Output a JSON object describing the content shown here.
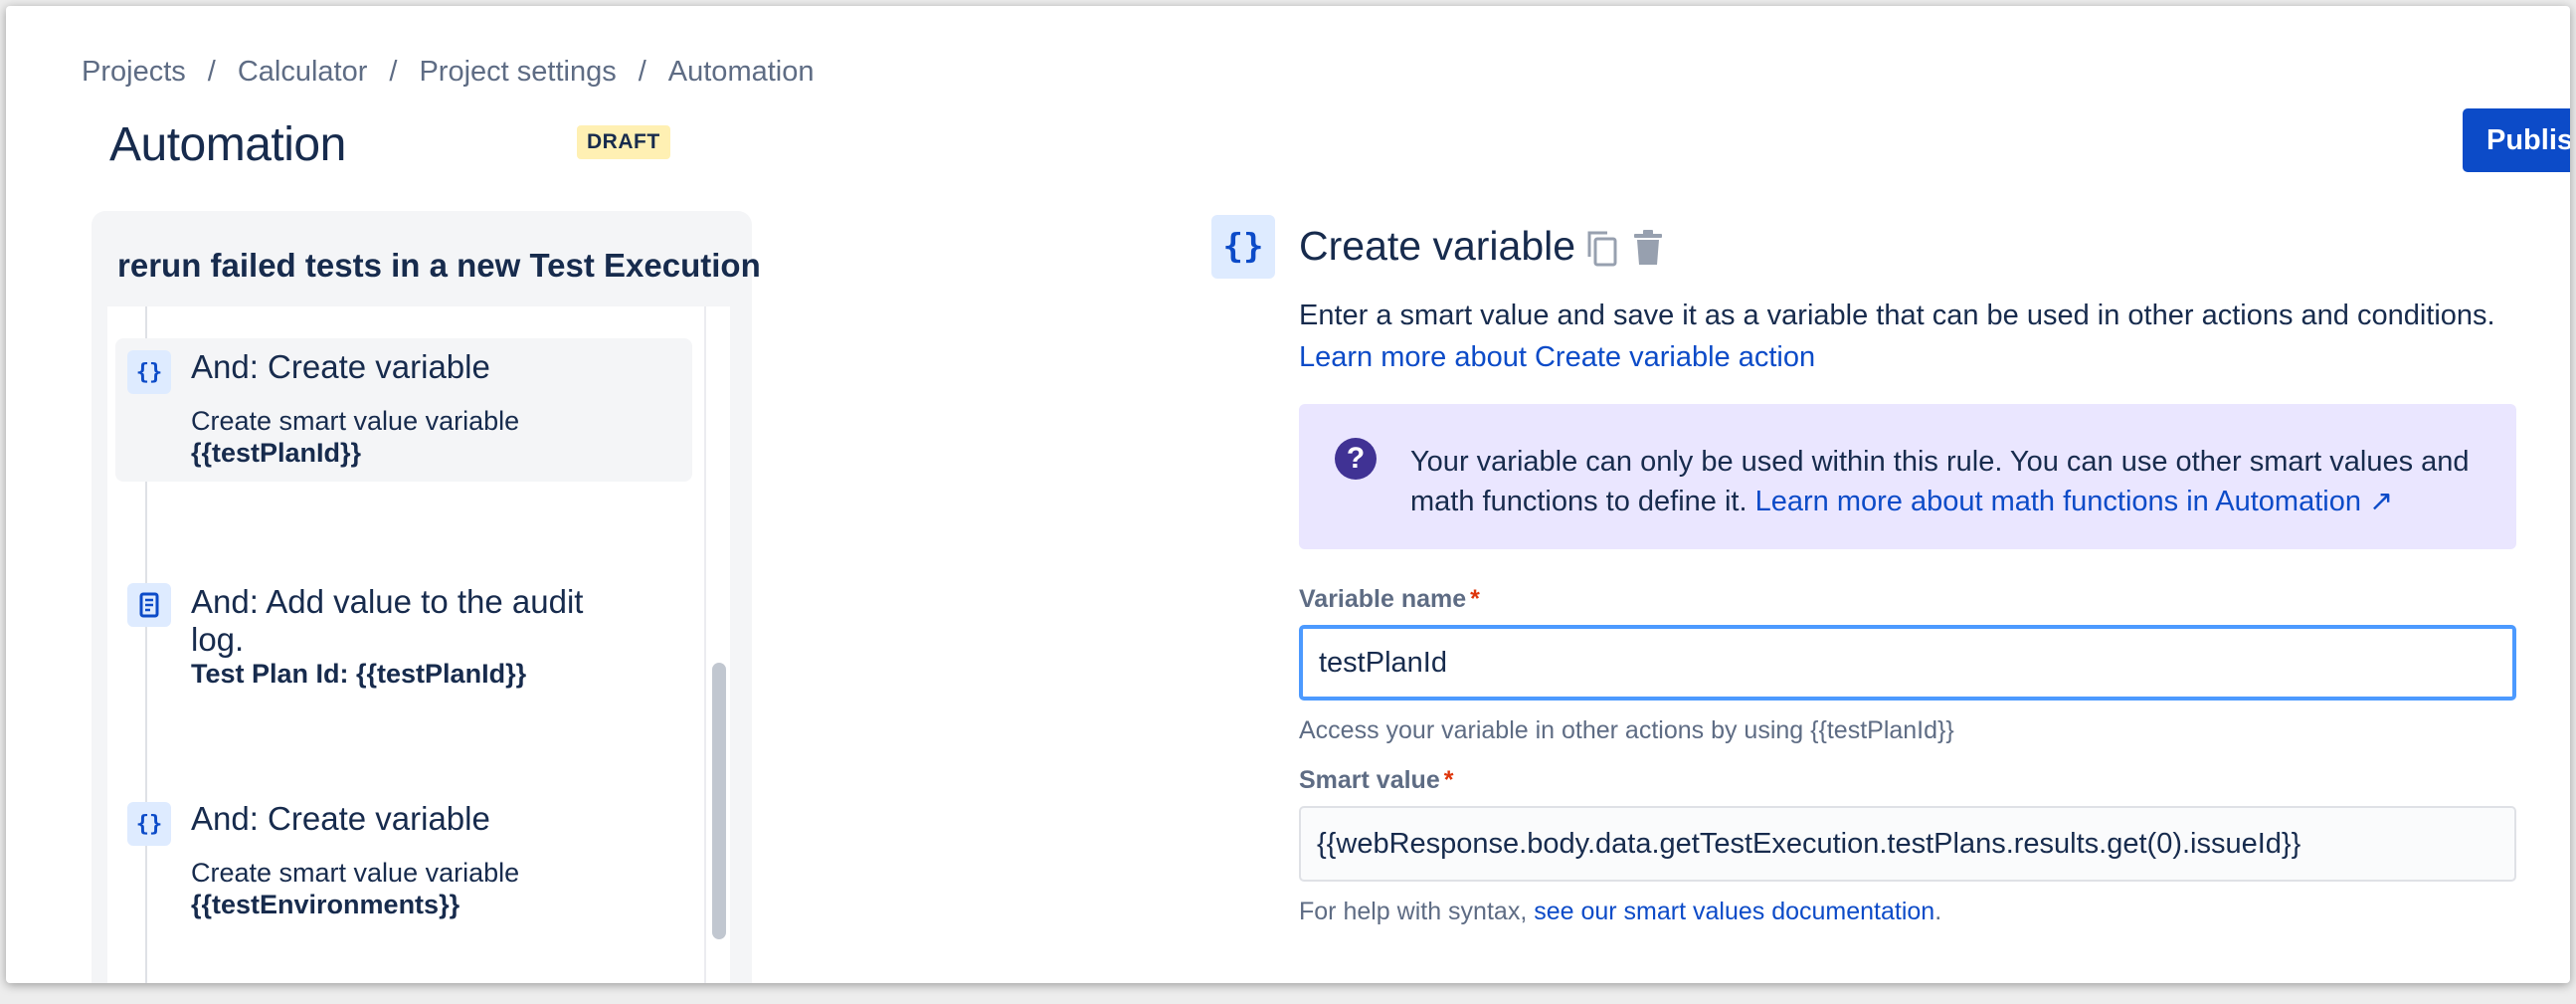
{
  "breadcrumb": {
    "items": [
      "Projects",
      "Calculator",
      "Project settings",
      "Automation"
    ],
    "separator": "/"
  },
  "header": {
    "title": "Automation",
    "status_badge": "DRAFT",
    "publish_label": "Publish"
  },
  "rule": {
    "name": "rerun failed tests in a new Test Execution",
    "steps": [
      {
        "icon": "curly-braces-icon",
        "glyph": "{}",
        "heading": "And: Create variable",
        "desc": "Create smart value variable",
        "bold": "{{testPlanId}}",
        "selected": true
      },
      {
        "icon": "document-icon",
        "heading_line1": "And: Add value to the audit",
        "heading_line2": "log.",
        "bold": "Test Plan Id: {{testPlanId}}",
        "selected": false
      },
      {
        "icon": "curly-braces-icon",
        "glyph": "{}",
        "heading": "And: Create variable",
        "desc": "Create smart value variable",
        "bold": "{{testEnvironments}}",
        "selected": false
      }
    ]
  },
  "config": {
    "icon_glyph": "{}",
    "title": "Create variable",
    "description": "Enter a smart value and save it as a variable that can be used in other actions and conditions.",
    "learn_more_link": "Learn more about Create variable action",
    "info": {
      "text": "Your variable can only be used within this rule. You can use other smart values and math functions to define it.",
      "link": "Learn more about math functions in Automation ↗"
    },
    "variable_name": {
      "label": "Variable name",
      "required_mark": "*",
      "value": "testPlanId",
      "helper": "Access your variable in other actions by using {{testPlanId}}"
    },
    "smart_value": {
      "label": "Smart value",
      "required_mark": "*",
      "value": "{{webResponse.body.data.getTestExecution.testPlans.results.get(0).issueId}}",
      "helper_prefix": "For help with syntax, ",
      "helper_link": "see our smart values documentation",
      "helper_suffix": "."
    }
  },
  "colors": {
    "primary": "#0c4bc8",
    "info_bg": "#eae6ff",
    "badge_bg": "#fff0b3",
    "focus_border": "#4c9aff"
  }
}
